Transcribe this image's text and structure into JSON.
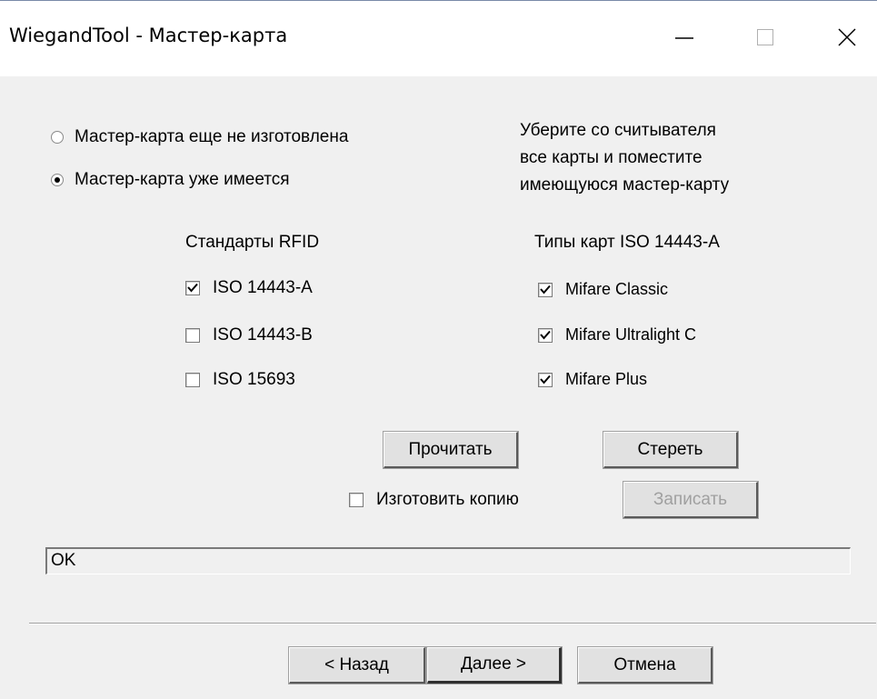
{
  "window": {
    "title": "WiegandTool - Мастер-карта",
    "minimize_icon": "minimize-icon",
    "maximize_icon": "maximize-icon",
    "close_icon": "close-icon"
  },
  "mode": {
    "options": [
      {
        "label": "Мастер-карта еще не изготовлена",
        "selected": false
      },
      {
        "label": "Мастер-карта уже имеется",
        "selected": true
      }
    ]
  },
  "hint": {
    "lines": [
      "Уберите со считывателя",
      "все карты и поместите",
      "имеющуюся мастер-карту"
    ]
  },
  "rfid": {
    "title": "Стандарты RFID",
    "items": [
      {
        "label": "ISO 14443-A",
        "checked": true
      },
      {
        "label": "ISO 14443-B",
        "checked": false
      },
      {
        "label": "ISO 15693",
        "checked": false
      }
    ]
  },
  "cardtypes": {
    "title": "Типы карт ISO 14443-A",
    "items": [
      {
        "label": "Mifare Classic",
        "checked": true
      },
      {
        "label": "Mifare Ultralight C",
        "checked": true
      },
      {
        "label": "Mifare Plus",
        "checked": true
      }
    ]
  },
  "actions": {
    "read_label": "Прочитать",
    "erase_label": "Стереть",
    "write_label": "Записать",
    "copy_label": "Изготовить копию",
    "copy_checked": false
  },
  "status": {
    "text": "OK"
  },
  "nav": {
    "back_label": "< Назад",
    "next_label": "Далее >",
    "cancel_label": "Отмена"
  }
}
